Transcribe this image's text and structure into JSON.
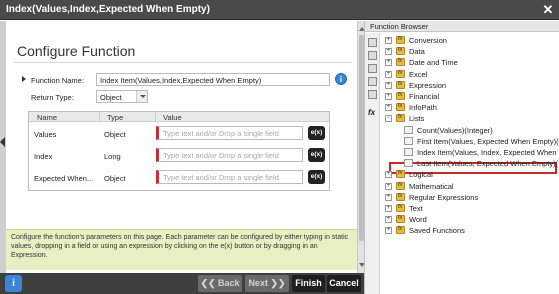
{
  "window": {
    "title": "Index(Values,Index,Expected When Empty)",
    "close_glyph": "✕"
  },
  "dialog": {
    "heading": "Configure Function",
    "function_name_label": "Function Name:",
    "function_name_value": "Index Item(Values,Index,Expected When Empty)",
    "info_glyph": "i",
    "return_type_label": "Return Type:",
    "return_type_value": "Object",
    "table": {
      "headers": [
        "Name",
        "Type",
        "Value"
      ],
      "rows": [
        {
          "name": "Values",
          "type": "Object",
          "placeholder": "Type text and/or Drop a single field",
          "button": "e(x)"
        },
        {
          "name": "Index",
          "type": "Long",
          "placeholder": "Type text and/or Drop a single field",
          "button": "e(x)"
        },
        {
          "name": "Expected When...",
          "type": "Object",
          "placeholder": "Type text and/or Drop a single field",
          "button": "e(x)"
        }
      ]
    },
    "help_text": "Configure the function's parameters on this page.  Each parameter can be configured by either typing in static values, dropping in a field or using an expression by clicking on the e(x) button or by dragging in an Expression."
  },
  "bottom_bar": {
    "info_glyph": "i",
    "back_label": "Back",
    "next_label": "Next",
    "finish_label": "Finish",
    "cancel_label": "Cancel"
  },
  "function_browser": {
    "title": "Function Browser",
    "toolbar_fx": "fx",
    "items": [
      {
        "label": "Conversion",
        "expander": "+",
        "kind": "folder"
      },
      {
        "label": "Data",
        "expander": "+",
        "kind": "folder"
      },
      {
        "label": "Date and Time",
        "expander": "+",
        "kind": "folder"
      },
      {
        "label": "Excel",
        "expander": "+",
        "kind": "folder"
      },
      {
        "label": "Expression",
        "expander": "+",
        "kind": "folder"
      },
      {
        "label": "Financial",
        "expander": "+",
        "kind": "folder"
      },
      {
        "label": "InfoPath",
        "expander": "+",
        "kind": "folder"
      },
      {
        "label": "Lists",
        "expander": "−",
        "kind": "folder"
      },
      {
        "label": "Count(Values)(Integer)",
        "expander": "",
        "kind": "leaf"
      },
      {
        "label": "First Item(Values, Expected When Empty)(",
        "expander": "",
        "kind": "leaf"
      },
      {
        "label": "Index Item(Values, Index, Expected When I",
        "expander": "",
        "kind": "leaf",
        "selected": true
      },
      {
        "label": "Last Item(Values, Expected When Empty)(",
        "expander": "",
        "kind": "leaf"
      },
      {
        "label": "Logical",
        "expander": "+",
        "kind": "folder"
      },
      {
        "label": "Mathematical",
        "expander": "+",
        "kind": "folder"
      },
      {
        "label": "Regular Expressions",
        "expander": "+",
        "kind": "folder"
      },
      {
        "label": "Text",
        "expander": "+",
        "kind": "folder"
      },
      {
        "label": "Word",
        "expander": "+",
        "kind": "folder"
      },
      {
        "label": "Saved Functions",
        "expander": "+",
        "kind": "folder"
      }
    ]
  }
}
